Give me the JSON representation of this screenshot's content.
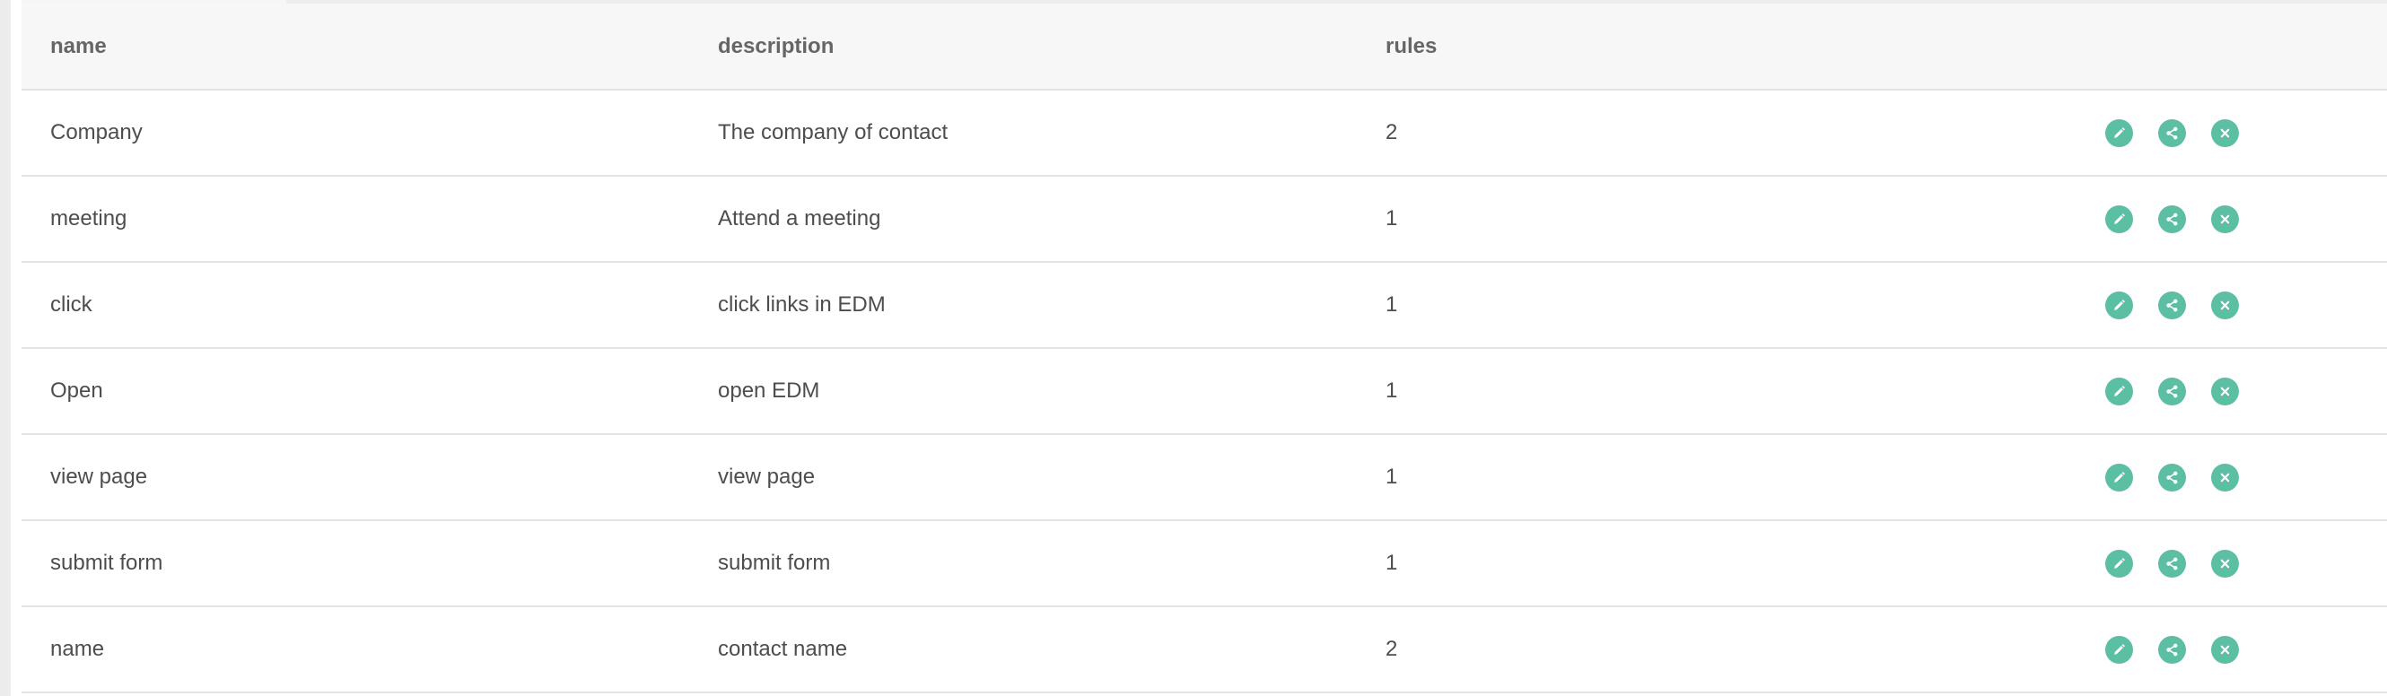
{
  "table": {
    "headers": {
      "name": "name",
      "description": "description",
      "rules": "rules"
    },
    "rows": [
      {
        "name": "Company",
        "description": "The company of contact",
        "rules": "2"
      },
      {
        "name": "meeting",
        "description": "Attend a meeting",
        "rules": "1"
      },
      {
        "name": "click",
        "description": "click links in EDM",
        "rules": "1"
      },
      {
        "name": "Open",
        "description": "open EDM",
        "rules": "1"
      },
      {
        "name": "view page",
        "description": "view page",
        "rules": "1"
      },
      {
        "name": "submit form",
        "description": "submit form",
        "rules": "1"
      },
      {
        "name": "name",
        "description": "contact name",
        "rules": "2"
      }
    ],
    "row_actions": [
      {
        "icon": "pencil-edit-icon",
        "color": "#5cbfa3"
      },
      {
        "icon": "share-icon",
        "color": "#5cbfa3"
      },
      {
        "icon": "close-delete-icon",
        "color": "#5cbfa3"
      }
    ]
  },
  "colors": {
    "accent": "#5cbfa3",
    "header_background": "#f7f7f7",
    "row_border": "#e4e4e4",
    "text": "#4d4d4d"
  }
}
